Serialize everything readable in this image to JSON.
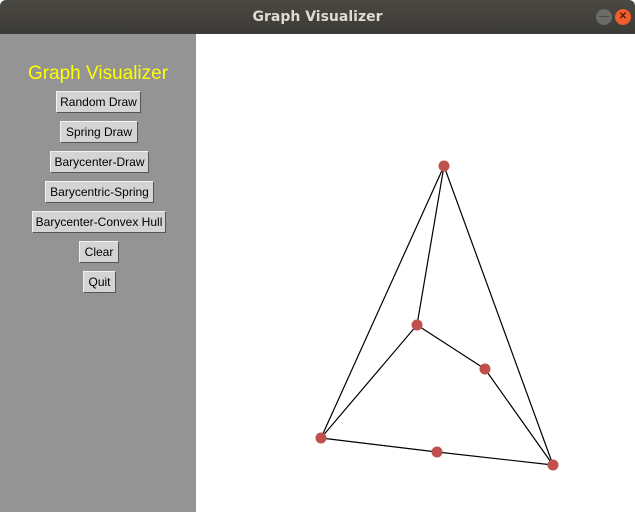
{
  "window": {
    "title": "Graph Visualizer",
    "minimize_icon": "minimize-icon",
    "close_icon": "close-icon"
  },
  "sidebar": {
    "app_title": "Graph Visualizer",
    "title_color": "#ffff00",
    "background": "#949494",
    "buttons": [
      {
        "label": "Random Draw"
      },
      {
        "label": "Spring Draw"
      },
      {
        "label": "Barycenter-Draw"
      },
      {
        "label": "Barycentric-Spring"
      },
      {
        "label": "Barycenter-Convex Hull"
      },
      {
        "label": "Clear"
      },
      {
        "label": "Quit"
      }
    ]
  },
  "graph": {
    "node_color": "#c0504d",
    "edge_color": "#000000",
    "nodes": [
      {
        "id": "top"
      },
      {
        "id": "center"
      },
      {
        "id": "right"
      },
      {
        "id": "bottom-left"
      },
      {
        "id": "bottom-mid"
      },
      {
        "id": "bottom-right"
      }
    ],
    "edges": [
      [
        "top",
        "bottom-left"
      ],
      [
        "top",
        "center"
      ],
      [
        "top",
        "bottom-right"
      ],
      [
        "center",
        "bottom-left"
      ],
      [
        "center",
        "right"
      ],
      [
        "right",
        "bottom-right"
      ],
      [
        "bottom-left",
        "bottom-mid"
      ],
      [
        "bottom-mid",
        "bottom-right"
      ]
    ]
  }
}
